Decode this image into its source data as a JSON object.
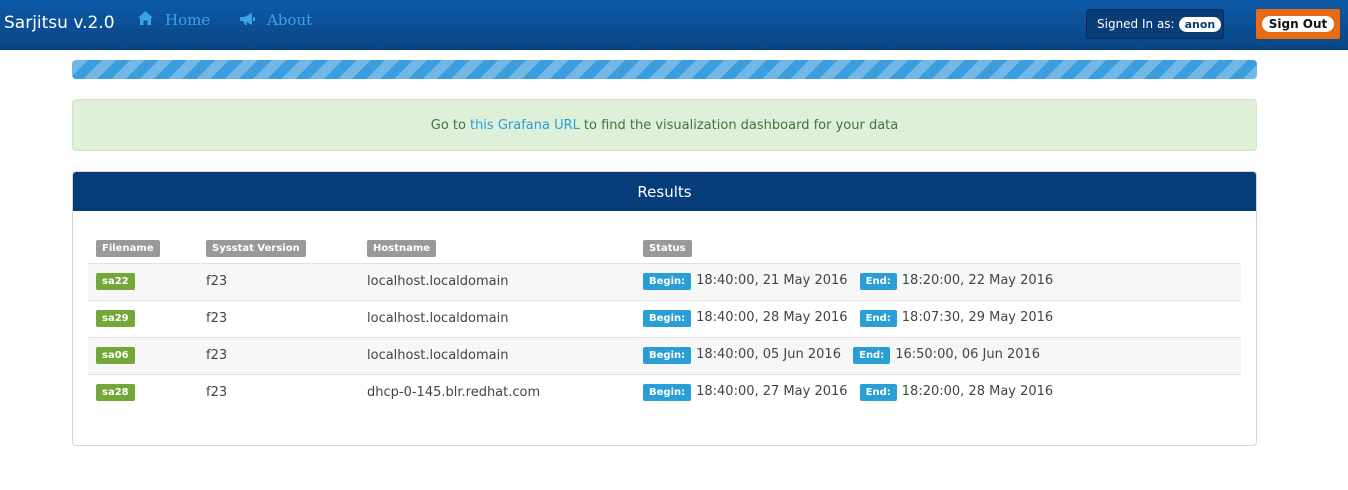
{
  "navbar": {
    "brand": "Sarjitsu v.2.0",
    "links": [
      {
        "label": "Home",
        "icon": "home-icon"
      },
      {
        "label": "About",
        "icon": "megaphone-icon"
      }
    ],
    "signed_in_label": "Signed In as:",
    "user": "anon",
    "sign_out_label": "Sign Out",
    "colors": {
      "bar": "#0a4585",
      "link": "#3aa3e6",
      "sign_out": "#e86a12"
    }
  },
  "progress": {
    "percent": 100,
    "striped": true,
    "color": "#3b9ddd"
  },
  "alert": {
    "prefix": "Go to",
    "link_text": "this Grafana URL",
    "suffix": "to find the visualization dashboard for your data"
  },
  "panel": {
    "title": "Results",
    "columns": [
      "Filename",
      "Sysstat Version",
      "Hostname",
      "Status"
    ],
    "rows": [
      {
        "filename": "sa22",
        "version": "f23",
        "hostname": "localhost.localdomain",
        "begin_label": "Begin:",
        "begin": "18:40:00, 21 May 2016",
        "end_label": "End:",
        "end": "18:20:00, 22 May 2016"
      },
      {
        "filename": "sa29",
        "version": "f23",
        "hostname": "localhost.localdomain",
        "begin_label": "Begin:",
        "begin": "18:40:00, 28 May 2016",
        "end_label": "End:",
        "end": "18:07:30, 29 May 2016"
      },
      {
        "filename": "sa06",
        "version": "f23",
        "hostname": "localhost.localdomain",
        "begin_label": "Begin:",
        "begin": "18:40:00, 05 Jun 2016",
        "end_label": "End:",
        "end": "16:50:00, 06 Jun 2016"
      },
      {
        "filename": "sa28",
        "version": "f23",
        "hostname": "dhcp-0-145.blr.redhat.com",
        "begin_label": "Begin:",
        "begin": "18:40:00, 27 May 2016",
        "end_label": "End:",
        "end": "18:20:00, 28 May 2016"
      }
    ]
  }
}
